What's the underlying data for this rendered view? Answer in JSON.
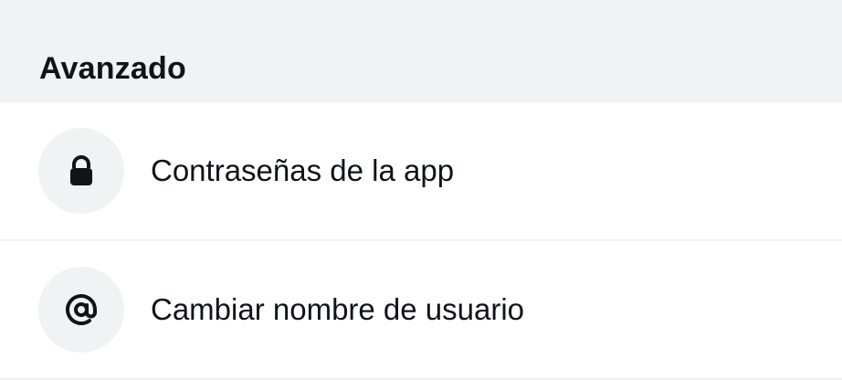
{
  "section": {
    "title": "Avanzado"
  },
  "items": [
    {
      "label": "Contraseñas de la app",
      "icon": "lock-icon"
    },
    {
      "label": "Cambiar nombre de usuario",
      "icon": "at-sign-icon"
    }
  ],
  "colors": {
    "header_background": "#eff3f4",
    "icon_circle_background": "#eff3f4",
    "text": "#0f1419",
    "divider": "#eff3f4"
  }
}
